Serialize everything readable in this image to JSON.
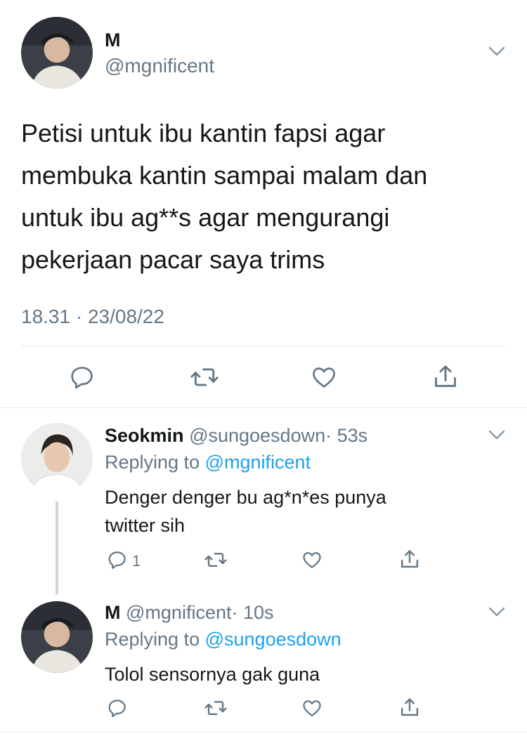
{
  "main_tweet": {
    "display_name": "M",
    "handle": "@mgnificent",
    "text_lines": [
      "Petisi untuk ibu kantin fapsi agar",
      "membuka kantin sampai malam dan",
      "untuk ibu ag**s agar mengurangi",
      "pekerjaan pacar saya trims"
    ],
    "timestamp": "18.31 · 23/08/22"
  },
  "replies": [
    {
      "display_name": "Seokmin",
      "handle": "@sungoesdown",
      "time": "· 53s",
      "replying_label": "Replying to",
      "replying_to": "@mgnificent",
      "text_lines": [
        "Denger denger bu ag*n*es punya",
        "twitter sih"
      ],
      "reply_count": "1"
    },
    {
      "display_name": "M",
      "handle": "@mgnificent",
      "time": "· 10s",
      "replying_label": "Replying to",
      "replying_to": "@sungoesdown",
      "text_lines": [
        "Tolol sensornya gak guna"
      ],
      "reply_count": ""
    }
  ],
  "icons": {
    "reply": "reply-icon",
    "retweet": "retweet-icon",
    "like": "heart-icon",
    "share": "share-icon",
    "more": "chevron-down-icon"
  },
  "colors": {
    "text": "#14171a",
    "secondary": "#657786",
    "link": "#1da1f2",
    "divider": "#e1e8ed"
  }
}
